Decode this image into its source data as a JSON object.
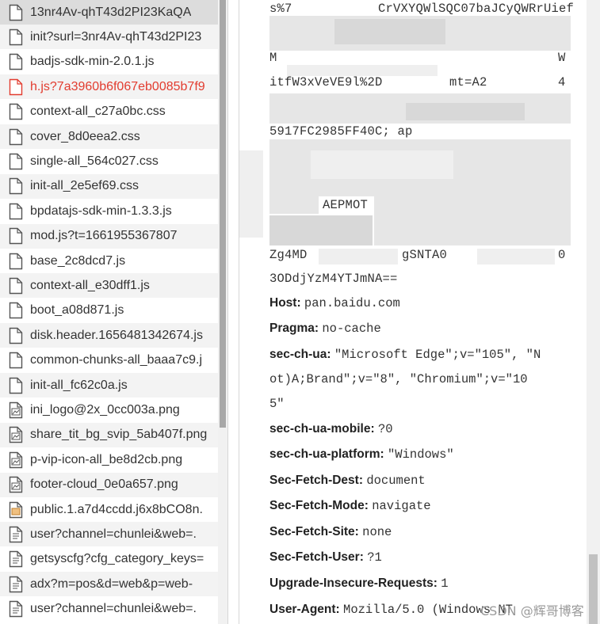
{
  "request_list": {
    "items": [
      {
        "name": "13nr4Av-qhT43d2PI23KaQA",
        "icon": "document-file-icon",
        "state": "selected"
      },
      {
        "name": "init?surl=3nr4Av-qhT43d2PI23",
        "icon": "document-file-icon",
        "state": ""
      },
      {
        "name": "badjs-sdk-min-2.0.1.js",
        "icon": "script-file-icon",
        "state": ""
      },
      {
        "name": "h.js?7a3960b6f067eb0085b7f9",
        "icon": "script-file-icon",
        "state": "error"
      },
      {
        "name": "context-all_c27a0bc.css",
        "icon": "stylesheet-file-icon",
        "state": ""
      },
      {
        "name": "cover_8d0eea2.css",
        "icon": "stylesheet-file-icon",
        "state": ""
      },
      {
        "name": "single-all_564c027.css",
        "icon": "stylesheet-file-icon",
        "state": ""
      },
      {
        "name": "init-all_2e5ef69.css",
        "icon": "stylesheet-file-icon",
        "state": ""
      },
      {
        "name": "bpdatajs-sdk-min-1.3.3.js",
        "icon": "script-file-icon",
        "state": ""
      },
      {
        "name": "mod.js?t=1661955367807",
        "icon": "script-file-icon",
        "state": ""
      },
      {
        "name": "base_2c8dcd7.js",
        "icon": "script-file-icon",
        "state": ""
      },
      {
        "name": "context-all_e30dff1.js",
        "icon": "script-file-icon",
        "state": ""
      },
      {
        "name": "boot_a08d871.js",
        "icon": "script-file-icon",
        "state": ""
      },
      {
        "name": "disk.header.1656481342674.js",
        "icon": "script-file-icon",
        "state": ""
      },
      {
        "name": "common-chunks-all_baaa7c9.j",
        "icon": "script-file-icon",
        "state": ""
      },
      {
        "name": "init-all_fc62c0a.js",
        "icon": "script-file-icon",
        "state": ""
      },
      {
        "name": "ini_logo@2x_0cc003a.png",
        "icon": "image-file-icon",
        "state": ""
      },
      {
        "name": "share_tit_bg_svip_5ab407f.png",
        "icon": "image-file-icon",
        "state": ""
      },
      {
        "name": "p-vip-icon-all_be8d2cb.png",
        "icon": "image-file-icon",
        "state": ""
      },
      {
        "name": "footer-cloud_0e0a657.png",
        "icon": "image-file-icon",
        "state": ""
      },
      {
        "name": "public.1.a7d4ccdd.j6x8bCO8n.",
        "icon": "font-file-icon",
        "state": ""
      },
      {
        "name": "user?channel=chunlei&web=.",
        "icon": "xhr-file-icon",
        "state": ""
      },
      {
        "name": "getsyscfg?cfg_category_keys=",
        "icon": "xhr-file-icon",
        "state": ""
      },
      {
        "name": "adx?m=pos&d=web&p=web-",
        "icon": "xhr-file-icon",
        "state": ""
      },
      {
        "name": "user?channel=chunlei&web=.",
        "icon": "xhr-file-icon",
        "state": ""
      }
    ]
  },
  "headers": {
    "fragments": [
      "s%7",
      "CrVXYQWlSQC07baJCyQWRrUief",
      "M",
      "W",
      "itfW3xVeVE9l%2D",
      "mt=A2",
      "4",
      "5917FC2985FF40C; ap",
      "AEPMOT",
      "Zg4MD",
      "gSNTA0",
      "0",
      "3ODdjYzM4YTJmNA=="
    ],
    "request_headers": [
      {
        "name": "Host:",
        "value": "pan.baidu.com"
      },
      {
        "name": "Pragma:",
        "value": "no-cache"
      },
      {
        "name": "sec-ch-ua:",
        "value": "\"Microsoft Edge\";v=\"105\", \"N"
      },
      {
        "name": "",
        "value": "ot)A;Brand\";v=\"8\", \"Chromium\";v=\"10"
      },
      {
        "name": "",
        "value": "5\""
      },
      {
        "name": "sec-ch-ua-mobile:",
        "value": "?0"
      },
      {
        "name": "sec-ch-ua-platform:",
        "value": "\"Windows\""
      },
      {
        "name": "Sec-Fetch-Dest:",
        "value": "document"
      },
      {
        "name": "Sec-Fetch-Mode:",
        "value": "navigate"
      },
      {
        "name": "Sec-Fetch-Site:",
        "value": "none"
      },
      {
        "name": "Sec-Fetch-User:",
        "value": "?1"
      },
      {
        "name": "Upgrade-Insecure-Requests:",
        "value": "1"
      },
      {
        "name": "User-Agent:",
        "value": "Mozilla/5.0 (Windows NT"
      }
    ]
  },
  "watermark": "CSDN @辉哥博客",
  "colors": {
    "error_text": "#e23c2f",
    "selected_row": "#dcdcdc",
    "mask_gray": "#e6e6e6"
  }
}
